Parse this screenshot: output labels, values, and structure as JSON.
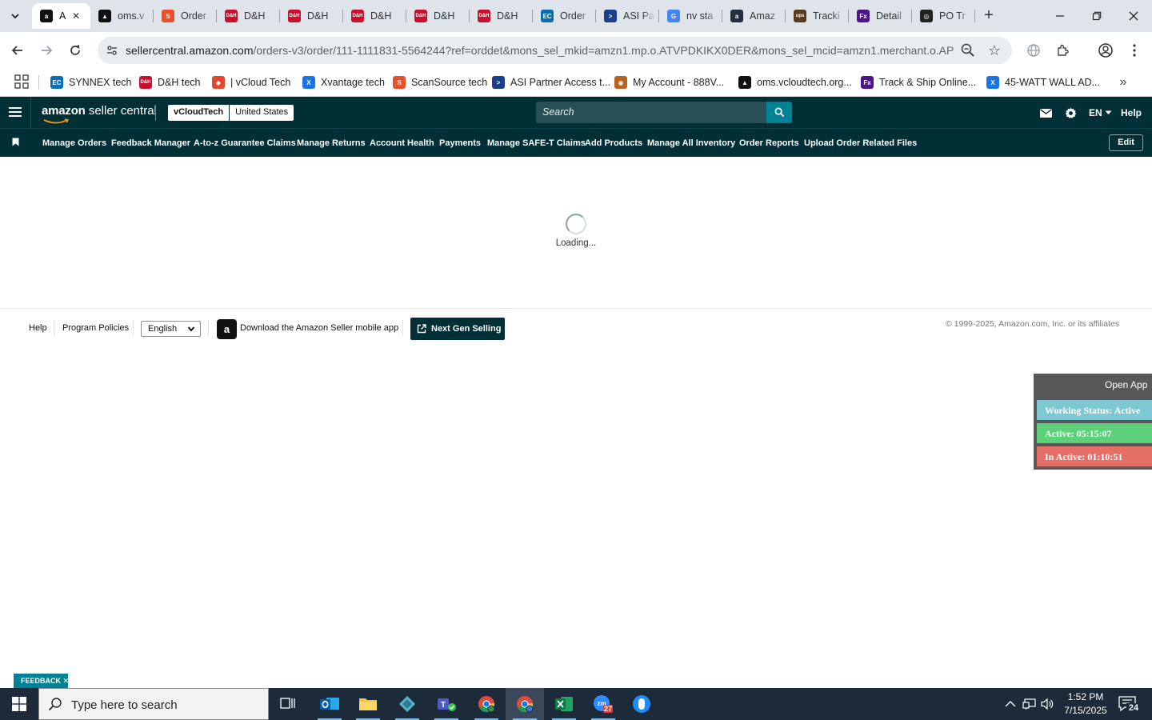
{
  "browser": {
    "tabs": [
      {
        "title": "A",
        "favicon": "amazon-icon",
        "color": "#111111",
        "glyph": "a",
        "active": true
      },
      {
        "title": "oms.v",
        "favicon": "oms-icon",
        "color": "#111111",
        "glyph": "▲"
      },
      {
        "title": "Order",
        "favicon": "scansource-icon",
        "color": "#e8502a",
        "glyph": "S"
      },
      {
        "title": "D&H",
        "favicon": "dh-icon",
        "color": "#c8102e",
        "glyph": "D&H"
      },
      {
        "title": "D&H",
        "favicon": "dh-icon",
        "color": "#c8102e",
        "glyph": "D&H"
      },
      {
        "title": "D&H",
        "favicon": "dh-icon",
        "color": "#c8102e",
        "glyph": "D&H"
      },
      {
        "title": "D&H",
        "favicon": "dh-icon",
        "color": "#c8102e",
        "glyph": "D&H"
      },
      {
        "title": "D&H",
        "favicon": "dh-icon",
        "color": "#c8102e",
        "glyph": "D&H"
      },
      {
        "title": "Order",
        "favicon": "synnex-icon",
        "color": "#0a6db0",
        "glyph": "EC"
      },
      {
        "title": "ASI Pa",
        "favicon": "asi-icon",
        "color": "#1b3f8b",
        "glyph": ">"
      },
      {
        "title": "nv sta",
        "favicon": "google-icon",
        "color": "#4285f4",
        "glyph": "G"
      },
      {
        "title": "Amaz",
        "favicon": "amazon-icon",
        "color": "#232f3e",
        "glyph": "a"
      },
      {
        "title": "Tracki",
        "favicon": "ups-icon",
        "color": "#5a3a1e",
        "glyph": "ups"
      },
      {
        "title": "Detail",
        "favicon": "fedex-icon",
        "color": "#4d148c",
        "glyph": "Fx"
      },
      {
        "title": "PO Tr",
        "favicon": "po-icon",
        "color": "#222222",
        "glyph": "◎"
      }
    ],
    "url_host": "sellercentral.amazon.com",
    "url_path": "/orders-v3/order/111-1111831-5564244?ref=orddet&mons_sel_mkid=amzn1.mp.o.ATVPDKIKX0DER&mons_sel_mcid=amzn1.merchant.o.AP...",
    "bookmarks": [
      {
        "label": "SYNNEX tech",
        "icon": "synnex-icon",
        "color": "#0a6db0",
        "glyph": "EC"
      },
      {
        "label": "D&H tech",
        "icon": "dh-icon",
        "color": "#c8102e",
        "glyph": "D&H"
      },
      {
        "label": "| vCloud Tech",
        "icon": "vcloud-icon",
        "color": "#e0472b",
        "glyph": "◆"
      },
      {
        "label": "Xvantage tech",
        "icon": "xvantage-icon",
        "color": "#1a73e8",
        "glyph": "X"
      },
      {
        "label": "ScanSource tech",
        "icon": "scansource-icon",
        "color": "#e8502a",
        "glyph": "S"
      },
      {
        "label": "ASI Partner Access t...",
        "icon": "asi-icon",
        "color": "#1b3f8b",
        "glyph": ">"
      },
      {
        "label": "My Account - 888V...",
        "icon": "account-icon",
        "color": "#b5651d",
        "glyph": "◉"
      },
      {
        "label": "oms.vcloudtech.org...",
        "icon": "oms-icon",
        "color": "#111111",
        "glyph": "▲"
      },
      {
        "label": "Track & Ship Online...",
        "icon": "fedex-icon",
        "color": "#4d148c",
        "glyph": "Fx"
      },
      {
        "label": "45-WATT WALL AD...",
        "icon": "xvantage-icon",
        "color": "#1a73e8",
        "glyph": "X"
      }
    ]
  },
  "seller": {
    "logo_brand": "amazon",
    "logo_product": "seller central",
    "account_name": "vCloudTech",
    "marketplace": "United States",
    "search_placeholder": "Search",
    "language": "EN",
    "help_label": "Help",
    "nav_links": [
      "Manage Orders",
      "Feedback Manager",
      "A-to-z Guarantee Claims",
      "Manage Returns",
      "Account Health",
      "Payments",
      "Manage SAFE-T Claims",
      "Add Products",
      "Manage All Inventory",
      "Order Reports",
      "Upload Order Related Files"
    ],
    "edit_label": "Edit",
    "brand_color": "#002f36",
    "accent_color": "#008296"
  },
  "main": {
    "loading_text": "Loading..."
  },
  "footer": {
    "help": "Help",
    "policies": "Program Policies",
    "language_selected": "English",
    "app_download": "Download the Amazon Seller mobile app",
    "next_gen": "Next Gen Selling",
    "copyright": "© 1999-2025, Amazon.com, Inc. or its affiliates"
  },
  "status_widget": {
    "open_app": "Open App",
    "working_status": "Working Status: Active",
    "active": "Active: 05:15:07",
    "inactive": "In Active: 01:10:51",
    "colors": {
      "working": "#7ec8d3",
      "active": "#5cd17a",
      "inactive": "#e46f66"
    }
  },
  "feedback": {
    "label": "FEEDBACK ✕"
  },
  "taskbar": {
    "search_placeholder": "Type here to search",
    "apps": [
      {
        "name": "task-view-icon",
        "active": false
      },
      {
        "name": "outlook-icon",
        "active": false
      },
      {
        "name": "file-explorer-icon",
        "active": false
      },
      {
        "name": "app-diamond-icon",
        "active": false
      },
      {
        "name": "teams-icon",
        "active": false
      },
      {
        "name": "chrome-icon",
        "active": false
      },
      {
        "name": "chrome-profile-icon",
        "active": true
      },
      {
        "name": "excel-icon",
        "active": false
      },
      {
        "name": "zoom-icon",
        "active": false,
        "badge": "27"
      },
      {
        "name": "app-blue-icon",
        "active": false
      }
    ],
    "time": "1:52 PM",
    "date": "7/15/2025",
    "notifications": "24"
  }
}
